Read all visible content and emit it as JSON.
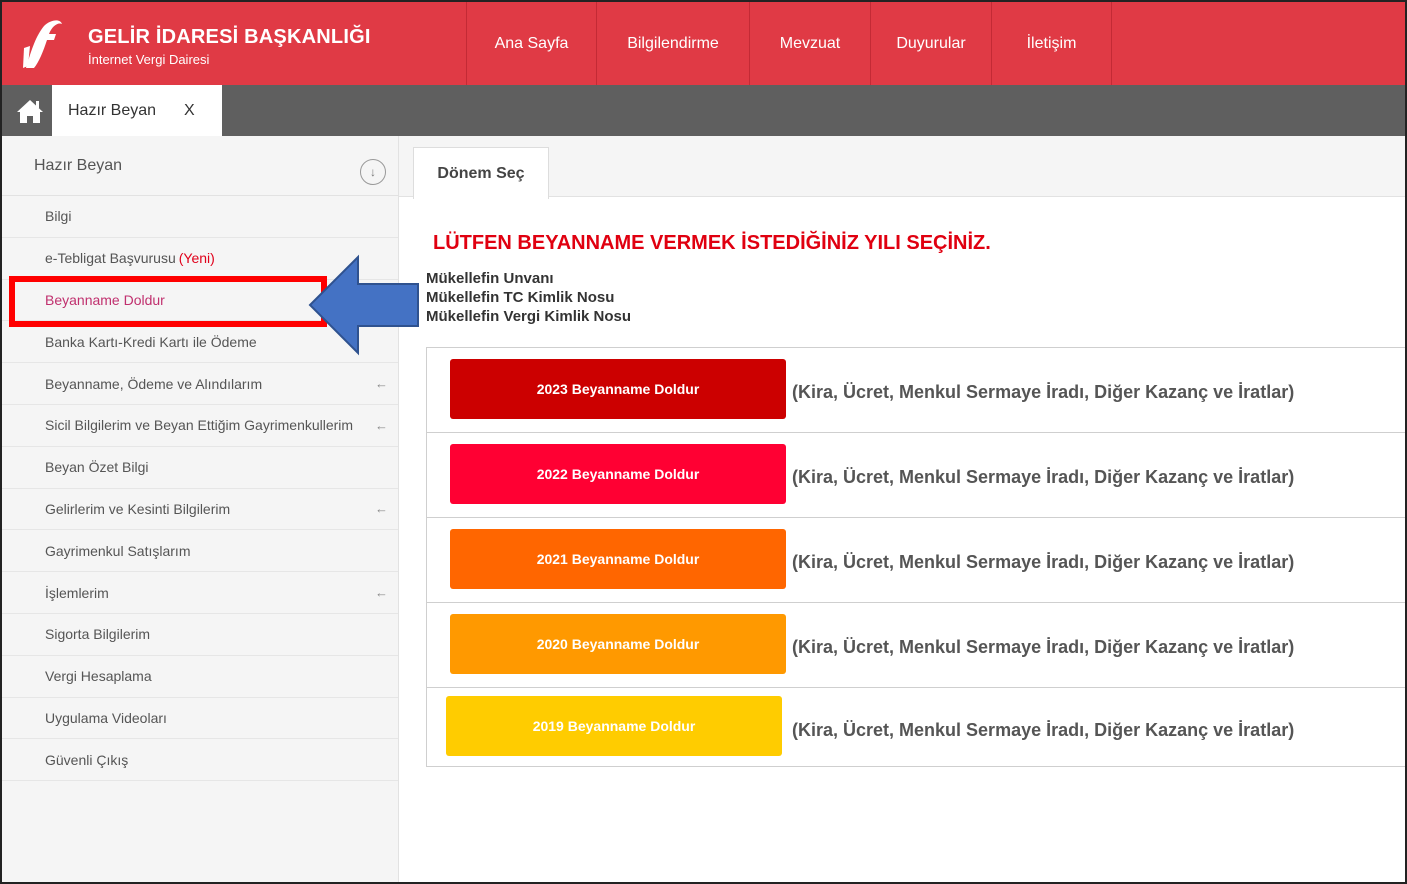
{
  "header": {
    "title": "GELİR İDARESİ BAŞKANLIĞI",
    "subtitle": "İnternet Vergi Dairesi",
    "nav": [
      {
        "label": "Ana Sayfa"
      },
      {
        "label": "Bilgilendirme"
      },
      {
        "label": "Mevzuat"
      },
      {
        "label": "Duyurular"
      },
      {
        "label": "İletişim"
      }
    ]
  },
  "tabs": {
    "active_label": "Hazır Beyan",
    "close_label": "X"
  },
  "sidebar": {
    "heading": "Hazır Beyan",
    "items": [
      {
        "label": "Bilgi",
        "extra": "",
        "arrow": ""
      },
      {
        "label": "e-Tebligat Başvurusu",
        "extra": "(Yeni)",
        "arrow": ""
      },
      {
        "label": "Beyanname Doldur",
        "extra": "",
        "arrow": ""
      },
      {
        "label": "Banka Kartı-Kredi Kartı ile Ödeme",
        "extra": "",
        "arrow": ""
      },
      {
        "label": "Beyanname, Ödeme ve Alındılarım",
        "extra": "",
        "arrow": "←"
      },
      {
        "label": "Sicil Bilgilerim ve Beyan Ettiğim Gayrimenkullerim",
        "extra": "",
        "arrow": "←"
      },
      {
        "label": "Beyan Özet Bilgi",
        "extra": "",
        "arrow": ""
      },
      {
        "label": "Gelirlerim ve Kesinti Bilgilerim",
        "extra": "",
        "arrow": "←"
      },
      {
        "label": "Gayrimenkul Satışlarım",
        "extra": "",
        "arrow": ""
      },
      {
        "label": "İşlemlerim",
        "extra": "",
        "arrow": "←"
      },
      {
        "label": "Sigorta Bilgilerim",
        "extra": "",
        "arrow": ""
      },
      {
        "label": "Vergi Hesaplama",
        "extra": "",
        "arrow": ""
      },
      {
        "label": "Uygulama Videoları",
        "extra": "",
        "arrow": ""
      },
      {
        "label": "Güvenli Çıkış",
        "extra": "",
        "arrow": ""
      }
    ]
  },
  "main": {
    "tab_label": "Dönem Seç",
    "headline": "LÜTFEN BEYANNAME VERMEK İSTEDİĞİNİZ YILI SEÇİNİZ.",
    "info_lines": [
      "Mükellefin Unvanı",
      "Mükellefin TC Kimlik Nosu",
      "Mükellefin Vergi Kimlik Nosu"
    ],
    "rows": [
      {
        "button": "2023 Beyanname Doldur",
        "color": "#cc0000",
        "desc": "(Kira, Ücret, Menkul Sermaye İradı, Diğer Kazanç ve İratlar)"
      },
      {
        "button": "2022 Beyanname Doldur",
        "color": "#ff0033",
        "desc": "(Kira, Ücret, Menkul Sermaye İradı, Diğer Kazanç ve İratlar)"
      },
      {
        "button": "2021 Beyanname Doldur",
        "color": "#ff6600",
        "desc": "(Kira, Ücret, Menkul Sermaye İradı, Diğer Kazanç ve İratlar)"
      },
      {
        "button": "2020 Beyanname Doldur",
        "color": "#ff9900",
        "desc": "(Kira, Ücret, Menkul Sermaye İradı, Diğer Kazanç ve İratlar)"
      },
      {
        "button": "2019 Beyanname Doldur",
        "color": "#ffcc00",
        "desc": "(Kira, Ücret, Menkul Sermaye İradı, Diğer Kazanç ve İratlar)"
      }
    ]
  },
  "colors": {
    "header_red": "#e03a45",
    "highlight_red": "#ff0000",
    "arrow_blue": "#4472c4",
    "headline_red": "#e00010"
  }
}
